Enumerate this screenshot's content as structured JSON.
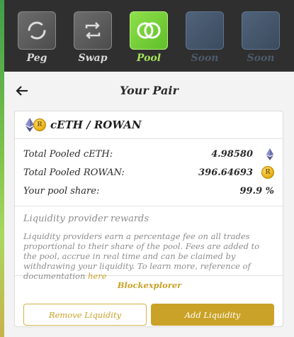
{
  "nav": {
    "items": [
      {
        "label": "Peg",
        "icon": "peg-icon",
        "state": "normal"
      },
      {
        "label": "Swap",
        "icon": "swap-icon",
        "state": "normal"
      },
      {
        "label": "Pool",
        "icon": "pool-icon",
        "state": "active"
      },
      {
        "label": "Soon",
        "icon": "placeholder-icon",
        "state": "disabled"
      },
      {
        "label": "Soon",
        "icon": "placeholder-icon",
        "state": "disabled"
      }
    ]
  },
  "header": {
    "back_icon": "arrow-left-icon",
    "title": "Your Pair"
  },
  "pair": {
    "title": "cETH / ROWAN",
    "stats": [
      {
        "label": "Total Pooled cETH:",
        "value": "4.98580",
        "icon": "ethereum-icon"
      },
      {
        "label": "Total Pooled ROWAN:",
        "value": "396.64693",
        "icon": "rowan-icon"
      },
      {
        "label": "Your pool share:",
        "value": "99.9 %"
      }
    ]
  },
  "rewards": {
    "title": "Liquidity provider rewards",
    "text": "Liquidity providers earn a percentage fee on all trades proportional to their share of the pool. Fees are added to the pool, accrue in real time and can be claimed by withdrawing your liquidity. To learn more, reference of documentation",
    "link": "here"
  },
  "explorer_label": "Blockexplorer",
  "buttons": {
    "remove": "Remove Liquidity",
    "add": "Add Liquidity"
  },
  "colors": {
    "accent": "#c9a227",
    "active_nav": "#8ee04a",
    "topbar": "#2f2f2f"
  }
}
